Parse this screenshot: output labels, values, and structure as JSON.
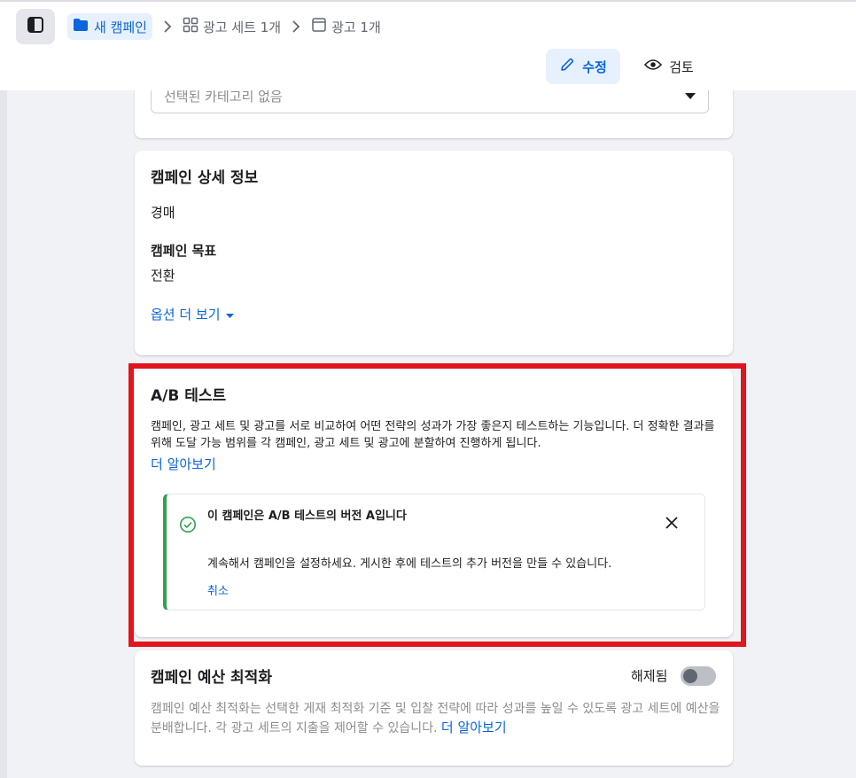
{
  "breadcrumb": {
    "campaign": "새 캠페인",
    "adset": "광고 세트 1개",
    "ad": "광고 1개"
  },
  "header": {
    "edit_label": "수정",
    "review_label": "검토"
  },
  "category": {
    "placeholder": "선택된 카테고리 없음"
  },
  "campaign_details": {
    "title": "캠페인 상세 정보",
    "buying_type": "경매",
    "objective_label": "캠페인 목표",
    "objective_value": "전환",
    "more_options": "옵션 더 보기"
  },
  "ab_test": {
    "title": "A/B 테스트",
    "description": "캠페인, 광고 세트 및 광고를 서로 비교하여 어떤 전략의 성과가 가장 좋은지 테스트하는 기능입니다. 더 정확한 결과를 위해 도달 가능 범위를 각 캠페인, 광고 세트 및 광고에 분할하여 진행하게 됩니다.",
    "learn_more": "더 알아보기",
    "notice": {
      "title": "이 캠페인은 A/B 테스트의 버전 A입니다",
      "body": "계속해서 캠페인을 설정하세요. 게시한 후에 테스트의 추가 버전을 만들 수 있습니다.",
      "cancel": "취소"
    }
  },
  "budget_optimization": {
    "title": "캠페인 예산 최적화",
    "status": "해제됨",
    "description": "캠페인 예산 최적화는 선택한 게재 최적화 기준 및 입찰 전략에 따라 성과를 높일 수 있도록 광고 세트에 예산을 분배합니다. 각 광고 세트의 지출을 제어할 수 있습니다.",
    "learn_more": "더 알아보기",
    "enabled": false
  },
  "colors": {
    "accent": "#0a66d9",
    "success": "#31a24c",
    "highlight": "#e0151d"
  }
}
